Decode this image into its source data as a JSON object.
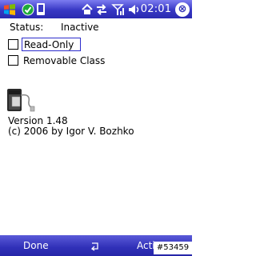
{
  "statusbar": {
    "time": "02:01",
    "close_glyph": "⊗"
  },
  "status": {
    "label": "Status:",
    "value": "Inactive"
  },
  "options": {
    "read_only": {
      "label": "Read-Only",
      "checked": false
    },
    "removable_class": {
      "label": "Removable Class",
      "checked": false
    }
  },
  "about": {
    "version": "Version 1.48",
    "copyright": "(c) 2006 by Igor V. Bozhko"
  },
  "menubar": {
    "left": "Done",
    "right": "Activate"
  },
  "watermark": "#53459",
  "colors": {
    "titlebar": "#3737c4",
    "menubar": "#3030b8",
    "focus": "#2c2ccc"
  }
}
